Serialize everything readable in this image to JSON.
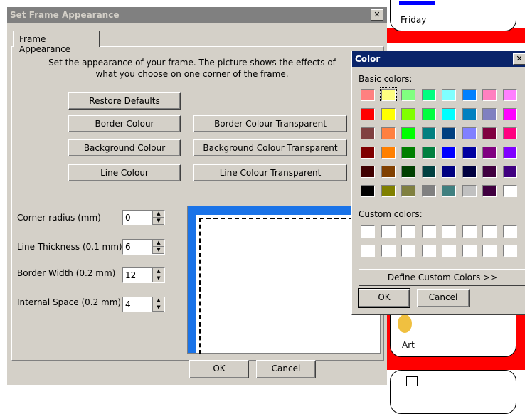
{
  "background": {
    "cards": [
      "Friday",
      "Art"
    ]
  },
  "dialog": {
    "title": "Set Frame Appearance",
    "close_glyph": "✕",
    "tab_label": "Frame Appearance",
    "description": "Set the appearance of your frame. The picture shows the effects of what you choose on one corner of the frame.",
    "buttons": {
      "restore": "Restore Defaults",
      "border_colour": "Border Colour",
      "border_transparent": "Border Colour Transparent",
      "background_colour": "Background Colour",
      "background_transparent": "Background Colour Transparent",
      "line_colour": "Line Colour",
      "line_transparent": "Line Colour Transparent"
    },
    "fields": [
      {
        "label": "Corner radius (mm)",
        "value": "0"
      },
      {
        "label": "Line Thickness (0.1 mm)",
        "value": "6"
      },
      {
        "label": "Border Width (0.2 mm)",
        "value": "12"
      },
      {
        "label": "Internal Space (0.2 mm)",
        "value": "4"
      }
    ],
    "ok": "OK",
    "cancel": "Cancel"
  },
  "color_dialog": {
    "title": "Color",
    "close_glyph": "✕",
    "basic_label": "Basic colors:",
    "custom_label": "Custom colors:",
    "define_label": "Define Custom Colors >>",
    "ok": "OK",
    "cancel": "Cancel",
    "selected_index": 1,
    "basic_colors": [
      "#ff8080",
      "#ffff80",
      "#80ff80",
      "#00ff80",
      "#80ffff",
      "#0080ff",
      "#ff80c0",
      "#ff80ff",
      "#ff0000",
      "#ffff00",
      "#80ff00",
      "#00ff40",
      "#00ffff",
      "#0080c0",
      "#8080c0",
      "#ff00ff",
      "#804040",
      "#ff8040",
      "#00ff00",
      "#008080",
      "#004080",
      "#8080ff",
      "#800040",
      "#ff0080",
      "#800000",
      "#ff8000",
      "#008000",
      "#008040",
      "#0000ff",
      "#0000a0",
      "#800080",
      "#8000ff",
      "#400000",
      "#804000",
      "#004000",
      "#004040",
      "#000080",
      "#000040",
      "#400040",
      "#400080",
      "#000000",
      "#808000",
      "#808040",
      "#808080",
      "#408080",
      "#c0c0c0",
      "#400040",
      "#ffffff"
    ]
  }
}
